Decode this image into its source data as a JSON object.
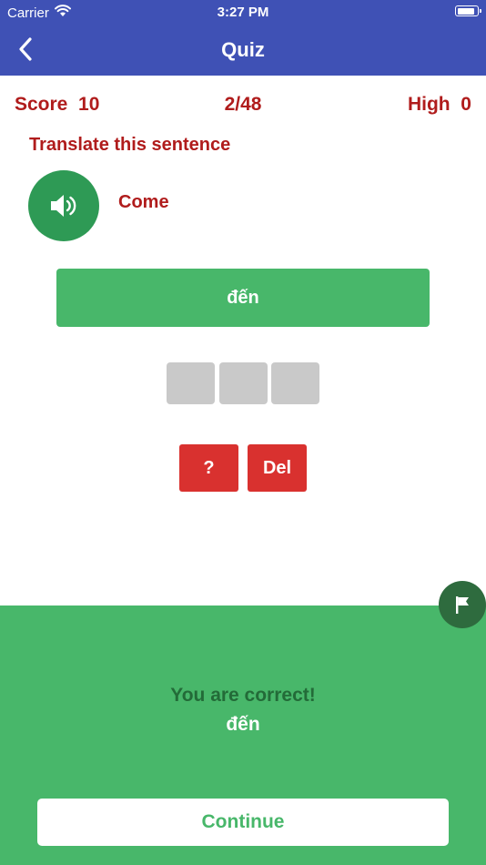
{
  "status_bar": {
    "carrier": "Carrier",
    "time": "3:27 PM",
    "wifi_icon": "wifi-icon",
    "battery_icon": "battery-icon"
  },
  "nav": {
    "title": "Quiz",
    "back_icon": "chevron-left-icon"
  },
  "scoreboard": {
    "score_label": "Score  10",
    "progress": "2/48",
    "high_label": "High  0"
  },
  "question": {
    "instruction": "Translate this sentence",
    "speaker_icon": "speaker-icon",
    "prompt_word": "Come",
    "answer_text": "đến"
  },
  "letter_slots": [
    "",
    "",
    ""
  ],
  "controls": {
    "hint_label": "?",
    "delete_label": "Del"
  },
  "result": {
    "message": "You are correct!",
    "answer": "đến",
    "continue_label": "Continue",
    "flag_icon": "flag-icon"
  },
  "colors": {
    "nav_blue": "#3f51b5",
    "accent_red": "#b01c1c",
    "button_red": "#d9312f",
    "green": "#48b76a",
    "dark_green": "#2e9a55",
    "flag_green": "#2e6b3e"
  }
}
